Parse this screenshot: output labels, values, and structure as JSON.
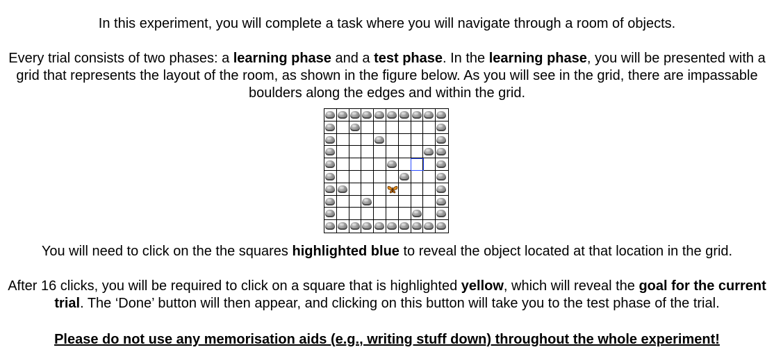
{
  "instructions": {
    "intro": "In this experiment, you will complete a task where you will navigate through a room of objects.",
    "phases": {
      "t1": "Every trial consists of two phases: a ",
      "b1": "learning phase",
      "t2": " and a ",
      "b2": "test phase",
      "t3": ". In the ",
      "b3": "learning phase",
      "t4": ", you will be presented with a grid that represents the layout of the room, as shown in the figure below. As you will see in the grid, there are impassable boulders along the edges and within the grid."
    },
    "click": {
      "t1": "You will need to click on the the squares ",
      "b1": "highlighted blue",
      "t2": " to reveal the object located at that location in the grid."
    },
    "goal": {
      "t1": "After 16 clicks, you will be required to click on a square that is highlighted ",
      "b1": "yellow",
      "t2": ", which will reveal the ",
      "b2": "goal for the current trial",
      "t3": ". The ‘Done’ button will then appear, and clicking on this button will take you to the test phase of the trial."
    },
    "warning": "Please do not use any memorisation aids (e.g., writing stuff down) throughout the whole experiment!"
  },
  "grid": {
    "rows": 10,
    "cols": 10,
    "boulders": [
      [
        0,
        0
      ],
      [
        0,
        1
      ],
      [
        0,
        2
      ],
      [
        0,
        3
      ],
      [
        0,
        4
      ],
      [
        0,
        5
      ],
      [
        0,
        6
      ],
      [
        0,
        7
      ],
      [
        0,
        8
      ],
      [
        0,
        9
      ],
      [
        9,
        0
      ],
      [
        9,
        1
      ],
      [
        9,
        2
      ],
      [
        9,
        3
      ],
      [
        9,
        4
      ],
      [
        9,
        5
      ],
      [
        9,
        6
      ],
      [
        9,
        7
      ],
      [
        9,
        8
      ],
      [
        9,
        9
      ],
      [
        1,
        0
      ],
      [
        2,
        0
      ],
      [
        3,
        0
      ],
      [
        4,
        0
      ],
      [
        5,
        0
      ],
      [
        6,
        0
      ],
      [
        7,
        0
      ],
      [
        8,
        0
      ],
      [
        1,
        9
      ],
      [
        2,
        9
      ],
      [
        3,
        9
      ],
      [
        4,
        9
      ],
      [
        5,
        9
      ],
      [
        6,
        9
      ],
      [
        7,
        9
      ],
      [
        8,
        9
      ],
      [
        1,
        2
      ],
      [
        2,
        4
      ],
      [
        3,
        8
      ],
      [
        4,
        5
      ],
      [
        5,
        6
      ],
      [
        6,
        1
      ],
      [
        7,
        3
      ],
      [
        8,
        7
      ]
    ],
    "highlighted_cell": [
      4,
      7
    ],
    "object_cell": [
      6,
      5
    ],
    "object_icon": "butterfly-icon",
    "highlight_color": "#2b4cff",
    "boulder_icon": "boulder-icon"
  }
}
